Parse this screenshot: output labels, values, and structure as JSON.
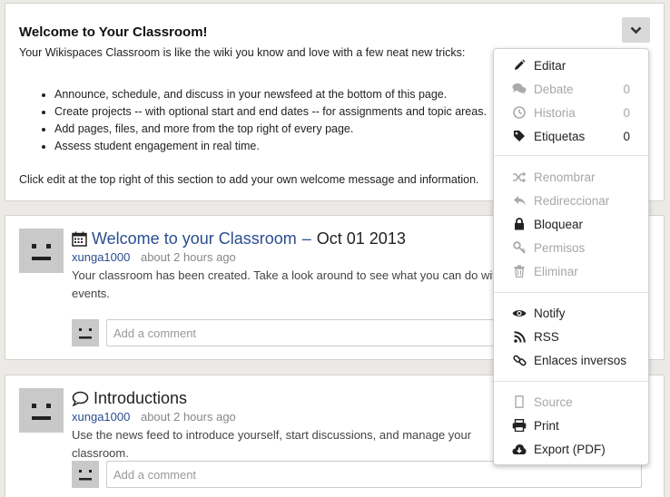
{
  "welcome": {
    "title": "Welcome to Your Classroom!",
    "intro": "Your Wikispaces Classroom is like the wiki you know and love with a few neat new tricks:",
    "bullets": [
      "Announce, schedule, and discuss in your newsfeed at the bottom of this page.",
      "Create projects -- with optional start and end dates -- for assignments and topic areas.",
      "Add pages, files, and more from the top right of every page.",
      "Assess student engagement in real time."
    ],
    "footer": "Click edit at the top right of this section to add your own welcome message and information."
  },
  "posts": [
    {
      "title": "Welcome to your Classroom",
      "separator": "–",
      "date": "Oct 01 2013",
      "author": "xunga1000",
      "time": "about 2 hours ago",
      "body": "Your classroom has been created. Take a look around to see what you can do with events.",
      "comment_placeholder": "Add a comment",
      "icon": "calendar-icon"
    },
    {
      "title": "Introductions",
      "author": "xunga1000",
      "time": "about 2 hours ago",
      "body": "Use the news feed to introduce yourself, start discussions, and manage your classroom.",
      "comment_placeholder": "Add a comment",
      "icon": "speech-bubble-icon"
    }
  ],
  "menu": {
    "items": [
      {
        "label": "Editar",
        "icon": "pencil-icon",
        "disabled": false
      },
      {
        "label": "Debate",
        "count": "0",
        "icon": "comments-icon",
        "disabled": true
      },
      {
        "label": "Historia",
        "count": "0",
        "icon": "clock-icon",
        "disabled": true
      },
      {
        "label": "Etiquetas",
        "count": "0",
        "icon": "tag-icon",
        "disabled": false
      },
      {
        "label": "Renombrar",
        "icon": "shuffle-icon",
        "disabled": true
      },
      {
        "label": "Redireccionar",
        "icon": "reply-arrow-icon",
        "disabled": true
      },
      {
        "label": "Bloquear",
        "icon": "lock-icon",
        "disabled": false
      },
      {
        "label": "Permisos",
        "icon": "key-icon",
        "disabled": true
      },
      {
        "label": "Eliminar",
        "icon": "trash-icon",
        "disabled": true
      },
      {
        "label": "Notify",
        "icon": "eye-icon",
        "disabled": false
      },
      {
        "label": "RSS",
        "icon": "rss-icon",
        "disabled": false
      },
      {
        "label": "Enlaces inversos",
        "icon": "link-icon",
        "disabled": false
      },
      {
        "label": "Source",
        "icon": "file-icon",
        "disabled": true
      },
      {
        "label": "Print",
        "icon": "printer-icon",
        "disabled": false
      },
      {
        "label": "Export (PDF)",
        "icon": "cloud-download-icon",
        "disabled": false
      }
    ]
  },
  "colors": {
    "link": "#2a4d8f",
    "disabled": "#a7a7a7",
    "background": "#eceae6"
  }
}
